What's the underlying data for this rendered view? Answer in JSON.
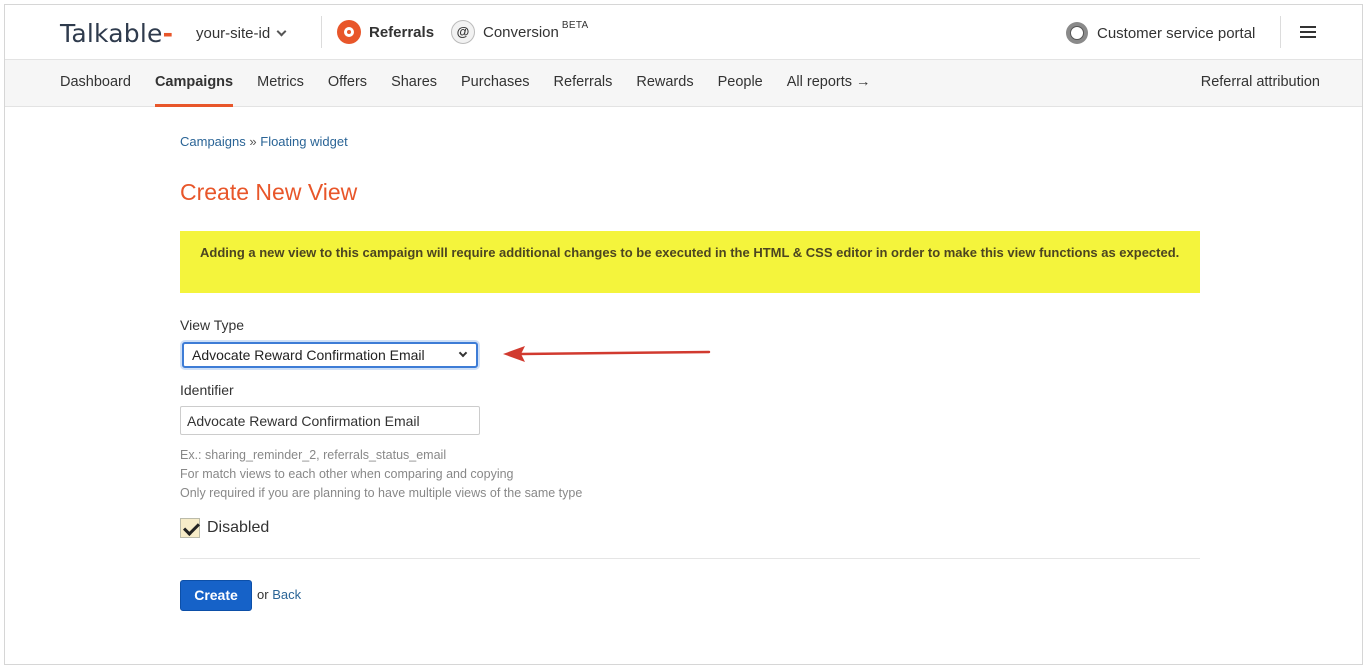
{
  "header": {
    "logo": "Talkable",
    "site_selector": "your-site-id",
    "products": [
      {
        "label": "Referrals",
        "icon": "referrals-icon"
      },
      {
        "label": "Conversion",
        "badge": "BETA",
        "icon": "at-sign-icon"
      }
    ],
    "portal_label": "Customer service portal",
    "menu_icon": "hamburger-icon"
  },
  "nav": {
    "items": [
      "Dashboard",
      "Campaigns",
      "Metrics",
      "Offers",
      "Shares",
      "Purchases",
      "Referrals",
      "Rewards",
      "People",
      "All reports →"
    ],
    "active": "Campaigns",
    "right_link": "Referral attribution"
  },
  "breadcrumb": {
    "campaigns": "Campaigns",
    "separator": "»",
    "current": "Floating widget"
  },
  "page": {
    "title": "Create New View",
    "alert": "Adding a new view to this campaign will require additional changes to be executed in the HTML & CSS editor in order to make this view functions as expected."
  },
  "form": {
    "view_type_label": "View Type",
    "view_type_value": "Advocate Reward Confirmation Email",
    "identifier_label": "Identifier",
    "identifier_value": "Advocate Reward Confirmation Email",
    "hints": [
      "Ex.: sharing_reminder_2, referrals_status_email",
      "For match views to each other when comparing and copying",
      "Only required if you are planning to have multiple views of the same type"
    ],
    "disabled_label": "Disabled",
    "disabled_checked": true,
    "create_button": "Create",
    "or_text": "or",
    "back_link": "Back"
  },
  "colors": {
    "brand_orange": "#e8562a",
    "alert_yellow": "#f4f43c",
    "primary_blue": "#1662c8",
    "annotation_arrow": "#d13a2f"
  }
}
